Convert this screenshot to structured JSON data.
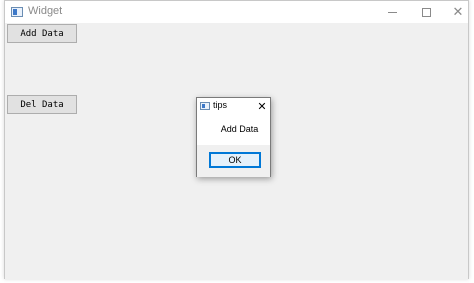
{
  "window": {
    "title": "Widget",
    "icon": "app-window-icon",
    "controls": {
      "minimize": "minimize-icon",
      "maximize": "maximize-icon",
      "close": "close-icon",
      "close_glyph": "✕"
    }
  },
  "buttons": {
    "add_label": "Add Data",
    "del_label": "Del Data"
  },
  "dialog": {
    "title": "tips",
    "icon": "app-window-icon",
    "close_glyph": "✕",
    "message": "Add Data",
    "ok_label": "OK"
  },
  "colors": {
    "accent": "#0078d7",
    "window_bg": "#f0f0f0",
    "button_bg": "#e1e1e1"
  }
}
